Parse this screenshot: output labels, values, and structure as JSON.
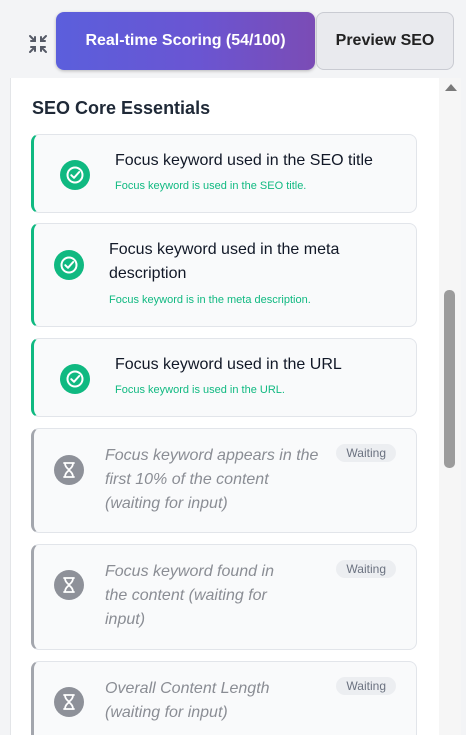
{
  "tabs": {
    "active_label": "Real-time Scoring (54/100)",
    "inactive_label": "Preview SEO"
  },
  "section": {
    "title": "SEO Core Essentials"
  },
  "checks": [
    {
      "status": "pass",
      "title": "Focus keyword used in the SEO title",
      "detail": "Focus keyword is used in the SEO title."
    },
    {
      "status": "pass",
      "title": "Focus keyword used in the meta description",
      "detail": "Focus keyword is in the meta description."
    },
    {
      "status": "pass",
      "title": "Focus keyword used in the URL",
      "detail": "Focus keyword is used in the URL."
    },
    {
      "status": "waiting",
      "title": "Focus keyword appears in the first 10% of the content (waiting for input)",
      "badge": "Waiting"
    },
    {
      "status": "waiting",
      "title": "Focus keyword found in the content (waiting for input)",
      "badge": "Waiting"
    },
    {
      "status": "waiting",
      "title": "Overall Content Length (waiting for input)",
      "badge": "Waiting"
    }
  ],
  "icons": {
    "collapse": "collapse-arrows-icon",
    "pass": "check-circle-icon",
    "waiting": "hourglass-icon"
  },
  "colors": {
    "accent_gradient_start": "#5b5fdc",
    "accent_gradient_end": "#7b4cb5",
    "pass_green": "#10b981",
    "waiting_gray": "#8e9199"
  }
}
